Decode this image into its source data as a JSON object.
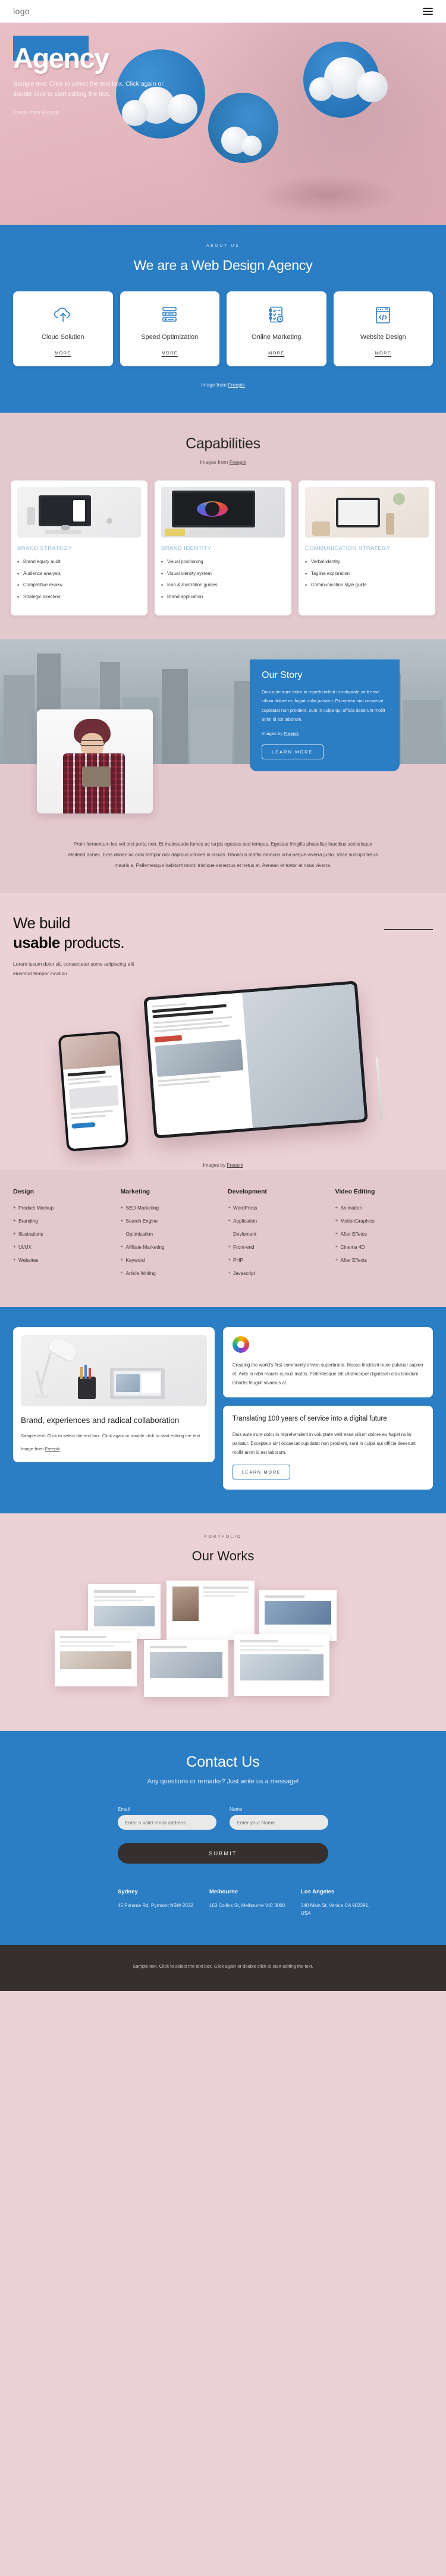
{
  "header": {
    "logo": "logo",
    "menu_icon": "hamburger-icon"
  },
  "hero": {
    "title": "Agency",
    "subtitle": "Sample text. Click to select the text box. Click again or double click to start editing the text.",
    "credit_prefix": "Image from ",
    "credit_link": "Freepik"
  },
  "about": {
    "eyebrow": "ABOUT US",
    "heading": "We are a Web Design Agency",
    "credit_prefix": "Image from ",
    "credit_link": "Freepik",
    "cards": [
      {
        "title": "Cloud Solution",
        "more": "MORE",
        "icon": "cloud-upload-icon"
      },
      {
        "title": "Speed Optimization",
        "more": "MORE",
        "icon": "server-rack-icon"
      },
      {
        "title": "Online Marketing",
        "more": "MORE",
        "icon": "checklist-clock-icon"
      },
      {
        "title": "Website Design",
        "more": "MORE",
        "icon": "code-window-icon"
      }
    ]
  },
  "capabilities": {
    "heading": "Capabilities",
    "credit_prefix": "Images from ",
    "credit_link": "Freepik",
    "cards": [
      {
        "title": "BRAND STRATEGY",
        "items": [
          "Brand equity audit",
          "Audience analysis",
          "Competitive review",
          "Strategic direction"
        ]
      },
      {
        "title": "BRAND IDENTITY",
        "items": [
          "Visual positioning",
          "Visual identity system",
          "Icon & illustration guides",
          "Brand application"
        ]
      },
      {
        "title": "COMMUNICATION STRATEGY",
        "items": [
          "Verbal identity",
          "Tagline exploration",
          "Communication style guide"
        ]
      }
    ]
  },
  "story": {
    "heading": "Our Story",
    "body": "Duis aute irure dolor in reprehenderit in voluptate velit esse cillum dolore eu fugiat nulla pariatur. Excepteur sint occaecat cupidatat non proident, sunt in culpa qui officia deserunt mollit anim id est laborum.",
    "credit_prefix": "Images by ",
    "credit_link": "Freepik",
    "button": "LEARN MORE",
    "paragraph": "Proin fermentum leo vel orci porta non. Et malesuada fames ac turpis egestas sed tempus. Egestas fringilla phasellus faucibus scelerisque eleifend donec. Eros donec ac odio tempor orci dapibus ultrices in iaculis. Rhoncus mattis rhoncus urna neque viverra justo. Vitae suscipit tellus mauris a. Pellentesque habitant morbi tristique senectus et netus et. Aenean et tortor at risus viverra."
  },
  "usable": {
    "line1": "We build",
    "line2_bold": "usable",
    "line2_rest": " products.",
    "subtitle": "Lorem ipsum dolor sit, consectetur some adipiscing elit eiusmod tempor incididu",
    "credit_prefix": "Images by ",
    "credit_link": "Freepik"
  },
  "link_columns": [
    {
      "heading": "Design",
      "items": [
        "Product Mockup",
        "Branding",
        "Illustrations",
        "UI/UX",
        "Websites"
      ]
    },
    {
      "heading": "Marketing",
      "items": [
        "SEO Marketing",
        "Search Engine",
        "Optimization",
        "Affiliate Marketing",
        "Keyword",
        "Article Writing"
      ]
    },
    {
      "heading": "Development",
      "items": [
        "WordPress",
        "Application",
        "Devloment",
        "Front-end",
        "PHP",
        "Javascript"
      ]
    },
    {
      "heading": "Video Editing",
      "items": [
        "Animation",
        "MotionGraphics",
        "After Effetcs",
        "Cinema 4D",
        "After Effects"
      ]
    }
  ],
  "brand": {
    "left_heading": "Brand, experiences and radical collaboration",
    "left_body": "Sample text. Click to select the text box. Click again or double click to start editing the text.",
    "left_credit_prefix": "Image from ",
    "left_credit_link": "Freepik",
    "top_card_body": "Creating the world's first community driven superbrand. Massa tincidunt nunc pulvinar sapien et. Ante in nibh mauris cursus mattis. Pellentesque elit ullamcorper dignissim cras tincidunt lobortis feugiat vivamus at.",
    "bottom_card_heading": "Translating 100 years of service into a digital future",
    "bottom_card_body": "Duis aute irure dolor in reprehenderit in voluptate velit esse cillum dolore eu fugiat nulla pariatur. Excepteur sint occaecat cupidatat non proident, sunt in culpa qui officia deserunt mollit anim id est laborum.",
    "bottom_card_button": "LEARN MORE",
    "color_wheel_icon": "color-wheel-icon"
  },
  "portfolio": {
    "eyebrow": "PORTFOLIO",
    "heading": "Our Works"
  },
  "contact": {
    "heading": "Contact Us",
    "lead": "Any questions or remarks? Just write us a message!",
    "email_label": "Email",
    "email_placeholder": "Enter a valid email address",
    "email_value": "",
    "name_label": "Name",
    "name_placeholder": "Enter your Name",
    "name_value": "",
    "submit": "SUBMIT",
    "offices": [
      {
        "city": "Sydney",
        "address": "45 Pirrama Rd, Pyrmont NSW 2022"
      },
      {
        "city": "Melbourne",
        "address": "163 Collins St, Melbourne VIC 3000"
      },
      {
        "city": "Los Angeles",
        "address": "340 Main St, Venice CA 902291, USA"
      }
    ]
  },
  "footer": {
    "text": "Sample text. Click to select the text box. Click again or double click to start editing the text."
  },
  "colors": {
    "brand_blue": "#2b7dc4",
    "pink": "#e3c8ce",
    "pink_light": "#ecd2d6",
    "dark": "#35302f"
  }
}
